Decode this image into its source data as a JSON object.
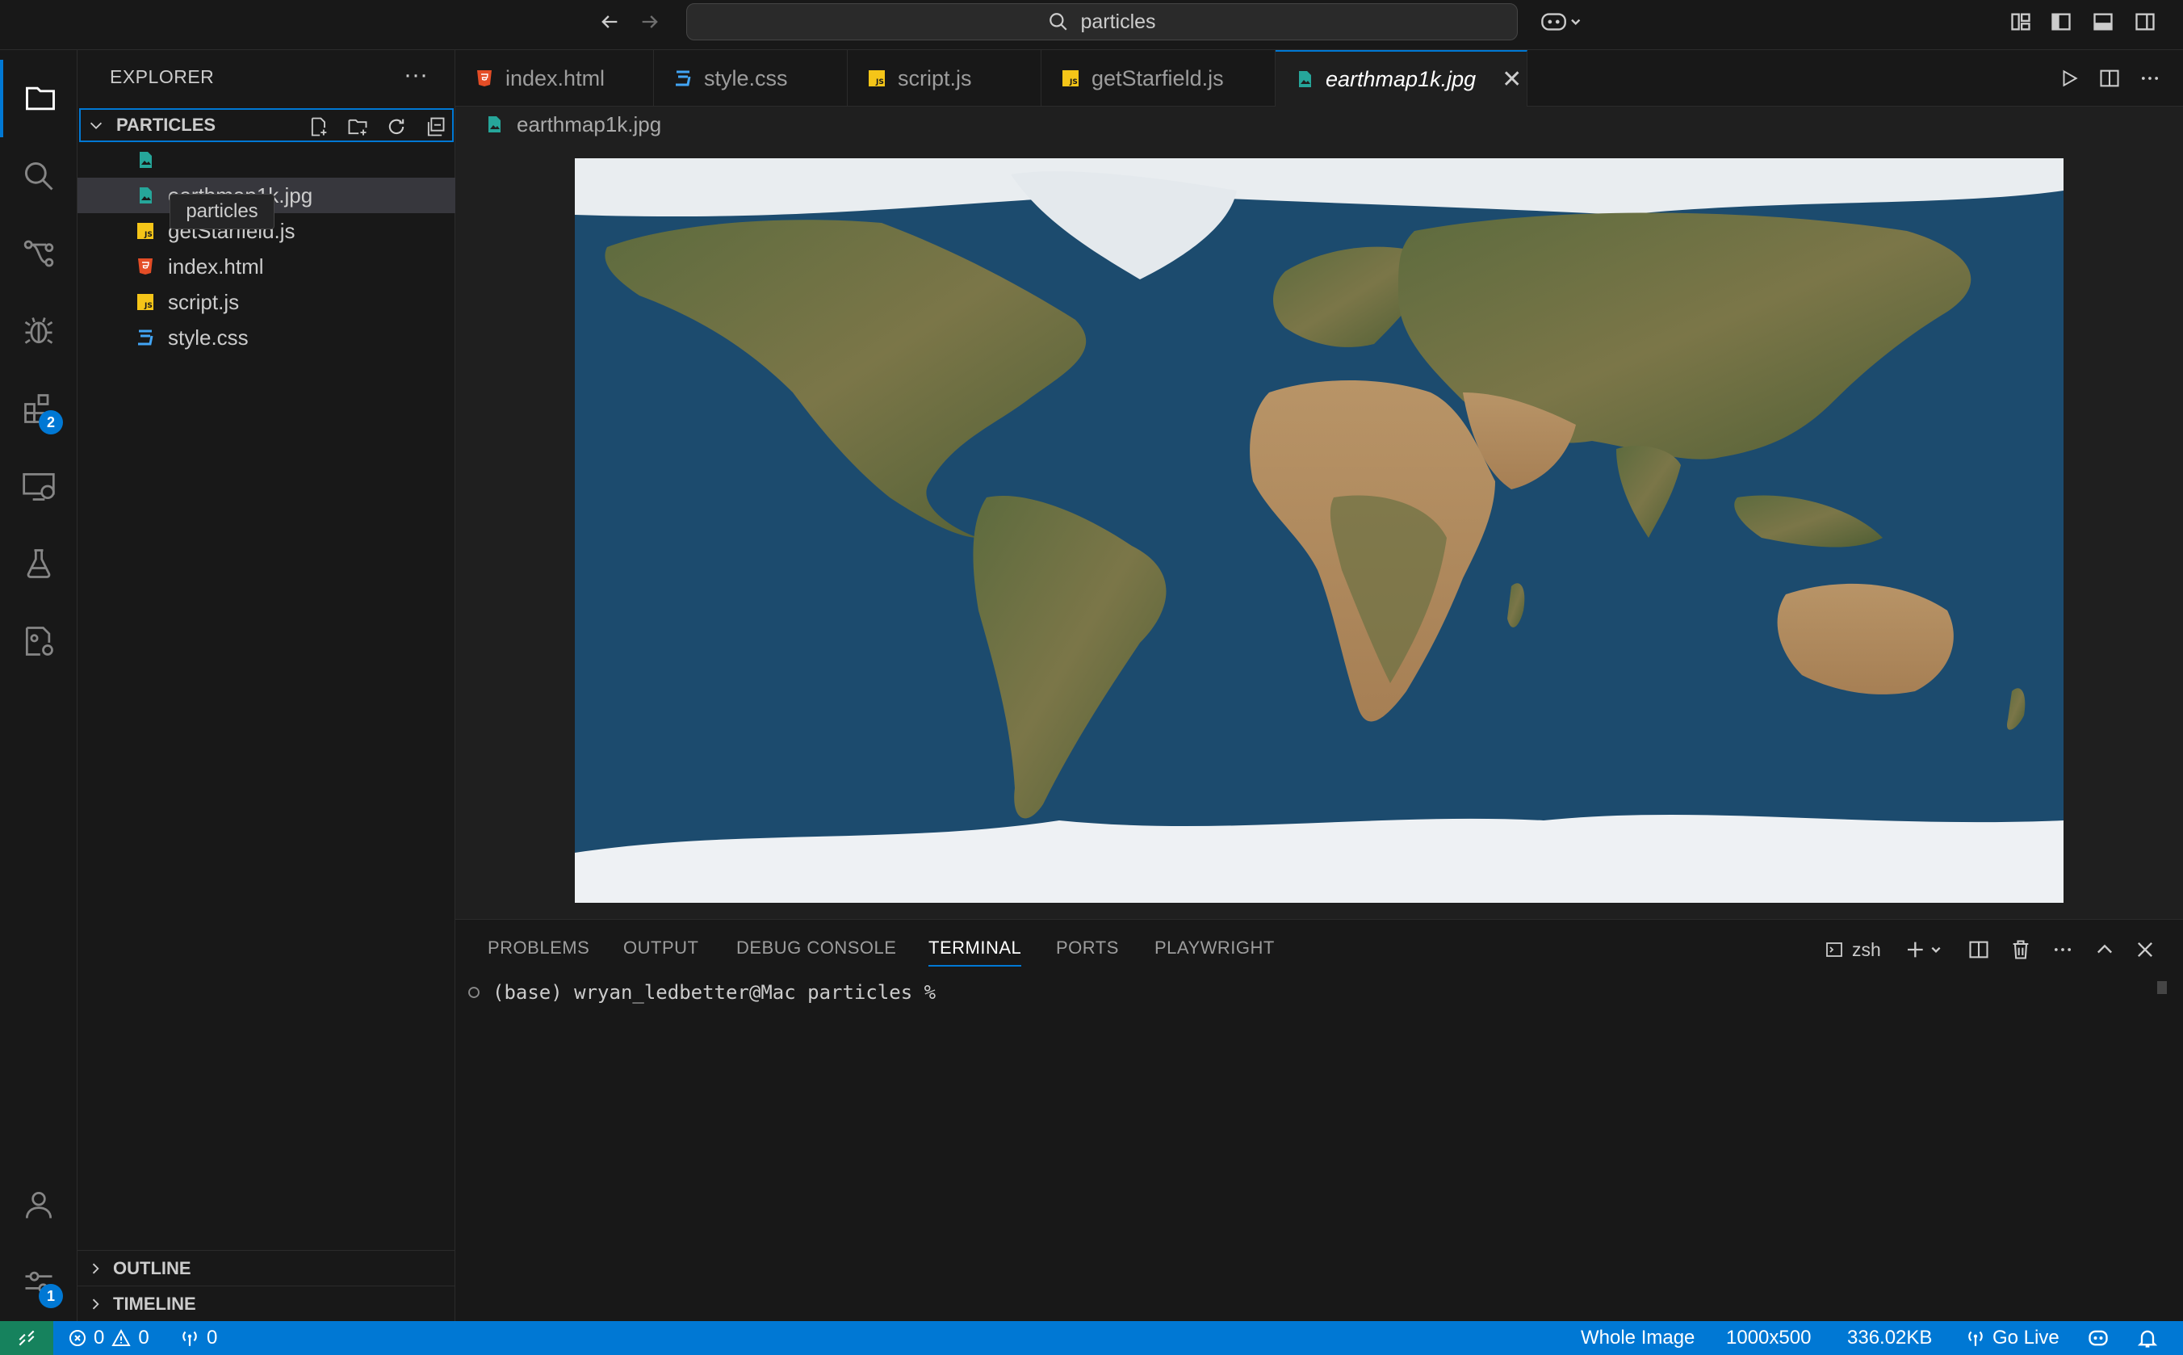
{
  "titlebar": {
    "search_text": "particles",
    "icons": [
      "arrow-left-icon",
      "arrow-right-icon",
      "search-icon",
      "copilot-icon",
      "customize-layout-icon",
      "toggle-primary-sidebar-icon",
      "toggle-panel-icon",
      "toggle-secondary-sidebar-icon"
    ]
  },
  "activity_bar": {
    "items": [
      {
        "icon": "files-icon",
        "active": true
      },
      {
        "icon": "search-icon"
      },
      {
        "icon": "source-control-icon"
      },
      {
        "icon": "run-debug-icon"
      },
      {
        "icon": "extensions-icon",
        "badge": "2"
      },
      {
        "icon": "remote-explorer-icon"
      },
      {
        "icon": "testing-icon"
      },
      {
        "icon": "settings-sync-icon"
      }
    ],
    "bottom": [
      {
        "icon": "accounts-icon"
      },
      {
        "icon": "manage-icon",
        "badge": "1"
      }
    ]
  },
  "sidebar": {
    "title": "EXPLORER",
    "more_label": "···",
    "folder": "PARTICLES",
    "tooltip": "particles",
    "files": [
      {
        "name": "",
        "type": "image"
      },
      {
        "name": "earthmap1k.jpg",
        "type": "image",
        "selected": true
      },
      {
        "name": "getStarfield.js",
        "type": "js"
      },
      {
        "name": "index.html",
        "type": "html"
      },
      {
        "name": "script.js",
        "type": "js"
      },
      {
        "name": "style.css",
        "type": "css"
      }
    ],
    "outline_label": "OUTLINE",
    "timeline_label": "TIMELINE"
  },
  "tabs": [
    {
      "label": "index.html",
      "type": "html"
    },
    {
      "label": "style.css",
      "type": "css"
    },
    {
      "label": "script.js",
      "type": "js"
    },
    {
      "label": "getStarfield.js",
      "type": "js"
    },
    {
      "label": "earthmap1k.jpg",
      "type": "image",
      "active": true,
      "close": "✕"
    }
  ],
  "breadcrumb": "earthmap1k.jpg",
  "panel": {
    "tabs": [
      "PROBLEMS",
      "OUTPUT",
      "DEBUG CONSOLE",
      "TERMINAL",
      "PORTS",
      "PLAYWRIGHT"
    ],
    "active_tab": "TERMINAL",
    "shell": "zsh",
    "terminal_line": "(base) wryan_ledbetter@Mac particles %"
  },
  "statusbar": {
    "errors": "0",
    "warnings": "0",
    "ports": "0",
    "zoom": "Whole Image",
    "dimensions": "1000x500",
    "size": "336.02KB",
    "go_live": "Go Live"
  },
  "colors": {
    "accent": "#0078d4",
    "remote": "#16825d",
    "html": "#e44d26",
    "css": "#42a5f5",
    "js": "#f5c518",
    "image": "#26a69a"
  }
}
